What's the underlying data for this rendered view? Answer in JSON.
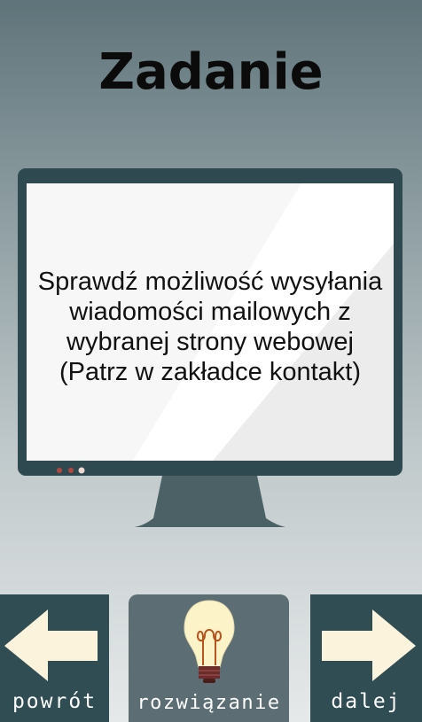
{
  "page": {
    "title": "Zadanie"
  },
  "task": {
    "text": "Sprawdź możliwość wysyłania\nwiadomości mailowych z\nwybranej strony webowej\n(Patrz w zakładce kontakt)"
  },
  "nav": {
    "back_label": "powrót",
    "solution_label": "rozwiązanie",
    "next_label": "dalej"
  },
  "colors": {
    "button_dark": "#2f4d52",
    "button_mid": "#5c6e73",
    "arrow_fill": "#fbf3dc",
    "monitor_frame": "#2e4a50",
    "bulb_glass": "#fdf3c8",
    "bulb_base": "#6d2b2b"
  },
  "icons": {
    "back": "arrow-left-icon",
    "solution": "light-bulb-icon",
    "next": "arrow-right-icon",
    "monitor": "monitor-icon"
  }
}
